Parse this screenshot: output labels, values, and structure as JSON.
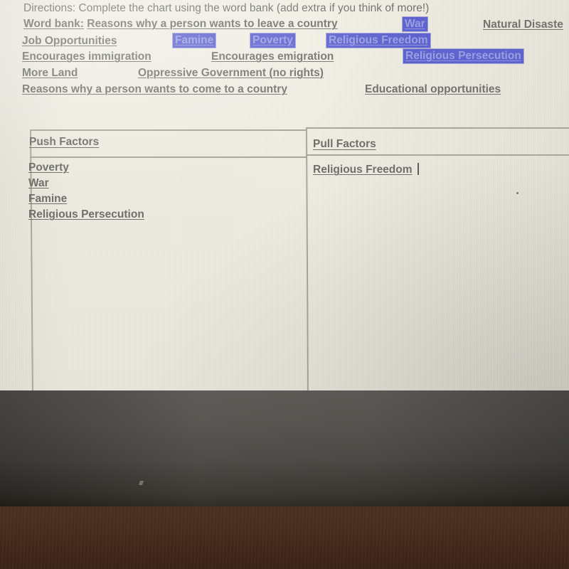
{
  "document": {
    "directions_prefix": "Directions:",
    "directions_text": " Complete the chart using the word bank (add extra if you think of more!)",
    "word_bank_label": "Word bank:",
    "word_bank_entries": [
      {
        "text": "Reasons why a person wants to leave a country",
        "highlighted": false
      },
      {
        "text": "War",
        "highlighted": true
      },
      {
        "text": "Natural Disaste",
        "highlighted": false
      },
      {
        "text": "Job Opportunities",
        "highlighted": false
      },
      {
        "text": "Famine",
        "highlighted": true
      },
      {
        "text": "Poverty",
        "highlighted": true
      },
      {
        "text": "Religious Freedom",
        "highlighted": true
      },
      {
        "text": "Encourages immigration",
        "highlighted": false
      },
      {
        "text": "Encourages emigration",
        "highlighted": false
      },
      {
        "text": "Religious Persecution",
        "highlighted": true
      },
      {
        "text": "More Land",
        "highlighted": false
      },
      {
        "text": "Oppressive Government (no rights)",
        "highlighted": false
      },
      {
        "text": "Reasons why a person wants to come to a country",
        "highlighted": false
      },
      {
        "text": "Educational opportunities",
        "highlighted": false
      }
    ]
  },
  "table": {
    "columns": [
      {
        "header": "Push Factors",
        "cells": [
          "Poverty",
          "War",
          "Famine",
          "Religious Persecution"
        ]
      },
      {
        "header": "Pull Factors",
        "cells": [
          "Religious Freedom"
        ]
      }
    ]
  },
  "colors": {
    "selection_highlight": "#5f63cf",
    "selected_text": "#9a9fe0",
    "body_text": "#72726e",
    "table_border": "#a9a79b",
    "paper": "#eeebdf",
    "laptop_deck": "#46443f",
    "desk": "#43291b"
  }
}
